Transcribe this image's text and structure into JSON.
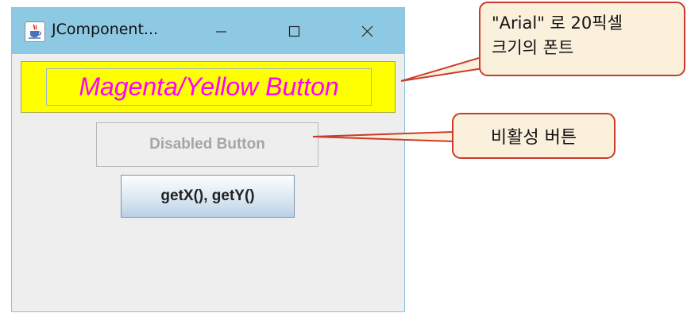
{
  "window": {
    "title": "JComponent...",
    "icons": {
      "app": "java-cup-icon",
      "minimize": "minimize-icon",
      "maximize": "maximize-icon",
      "close": "close-icon"
    }
  },
  "buttons": {
    "styled_label": "Magenta/Yellow Button",
    "disabled_label": "Disabled Button",
    "coords_label": "getX(), getY()"
  },
  "callouts": {
    "font_line1": "\"Arial\" 로 20픽셀",
    "font_line2": "크기의 폰트",
    "disabled_note": "비활성 버튼"
  },
  "colors": {
    "titlebar": "#8ec9e3",
    "styled_button_bg": "#ffff00",
    "styled_button_fg": "#ff00ff",
    "callout_bg": "#fbf0dc",
    "callout_border": "#c93b2c"
  }
}
